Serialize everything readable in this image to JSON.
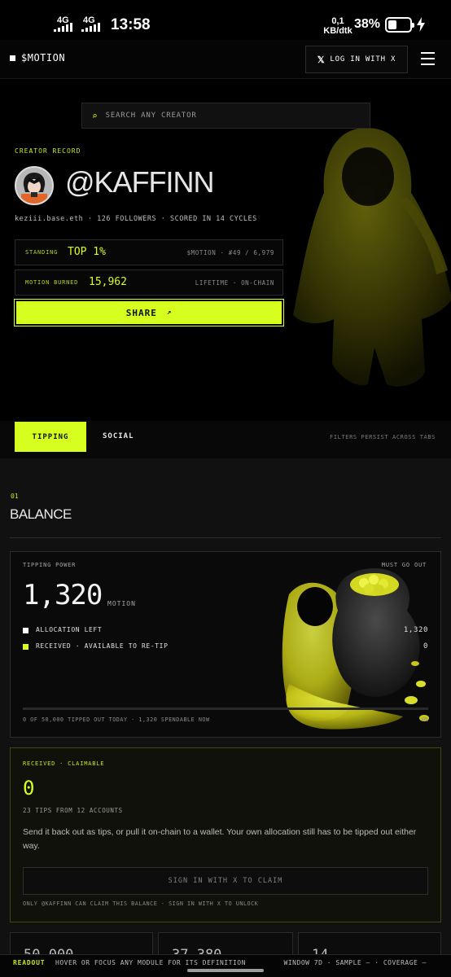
{
  "status_bar": {
    "net1": "4G",
    "net2": "4G",
    "time": "13:58",
    "speed_value": "0,1",
    "speed_unit": "KB/dtk",
    "battery_pct": "38%",
    "battery_level": 0.38
  },
  "header": {
    "brand": "$MOTION",
    "login_label": "LOG IN WITH X",
    "login_icon": "x-logo-icon",
    "menu_icon": "hamburger-menu-icon"
  },
  "search": {
    "placeholder": "SEARCH ANY CREATOR",
    "icon": "search-icon"
  },
  "creator": {
    "section_label": "CREATOR RECORD",
    "handle": "@KAFFINN",
    "meta": "keziii.base.eth · 126 FOLLOWERS · SCORED IN 14 CYCLES",
    "standing": {
      "label": "STANDING",
      "value": "TOP 1%",
      "right": "$MOTION · #49 / 6,979"
    },
    "burned": {
      "label": "MOTION BURNED",
      "value": "15,962",
      "right": "LIFETIME · ON-CHAIN"
    },
    "share_label": "SHARE",
    "share_icon": "↗"
  },
  "tabs": {
    "items": [
      "TIPPING",
      "SOCIAL"
    ],
    "active": "TIPPING",
    "note": "FILTERS PERSIST ACROSS TABS"
  },
  "balance_section": {
    "number": "01",
    "title": "BALANCE"
  },
  "tipping_power": {
    "label": "TIPPING POWER",
    "must_go_out": "MUST GO OUT",
    "amount": "1,320",
    "unit": "MOTION",
    "rows": [
      {
        "label": "ALLOCATION LEFT",
        "value": "1,320",
        "color": "#ffffff"
      },
      {
        "label": "RECEIVED · AVAILABLE TO RE-TIP",
        "value": "0",
        "color": "#d6ff1f"
      }
    ],
    "progress_fraction": 0,
    "footnote": "0 OF 50,000 TIPPED OUT TODAY · 1,320 SPENDABLE NOW",
    "pct": "0%"
  },
  "received": {
    "label": "RECEIVED · CLAIMABLE",
    "amount": "0",
    "sub": "23 TIPS FROM 12 ACCOUNTS",
    "description": "Send it back out as tips, or pull it on-chain to a wallet. Your own allocation still has to be tipped out either way.",
    "claim_button": "SIGN IN WITH X TO CLAIM",
    "note": "ONLY @KAFFINN CAN CLAIM THIS BALANCE · SIGN IN WITH X TO UNLOCK"
  },
  "mini_cards": [
    {
      "value": "50,000"
    },
    {
      "value": "37,380"
    },
    {
      "value": "14"
    }
  ],
  "readout": {
    "label": "READOUT",
    "hint": "HOVER OR FOCUS ANY MODULE FOR ITS DEFINITION",
    "right": "WINDOW 7D · SAMPLE — · COVERAGE —"
  },
  "colors": {
    "accent": "#d6ff1f",
    "background": "#0b0b0b"
  }
}
